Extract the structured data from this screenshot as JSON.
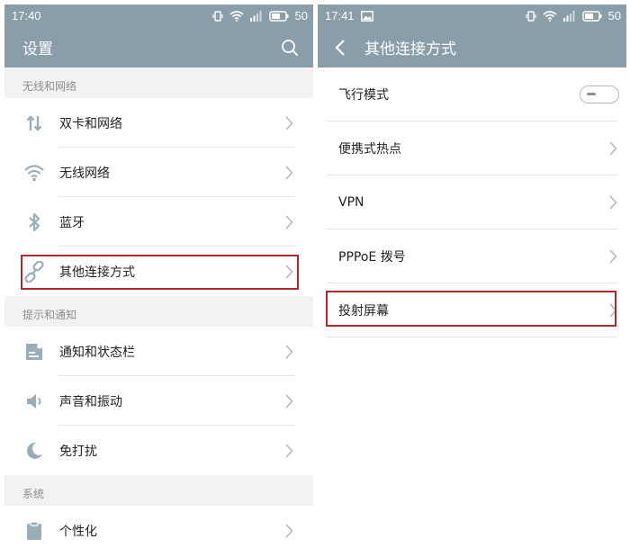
{
  "left": {
    "status": {
      "time": "17:40",
      "battery": "50"
    },
    "title": "设置",
    "sections": [
      {
        "header": "无线和网络",
        "items": [
          {
            "label": "双卡和网络"
          },
          {
            "label": "无线网络"
          },
          {
            "label": "蓝牙"
          },
          {
            "label": "其他连接方式"
          }
        ]
      },
      {
        "header": "提示和通知",
        "items": [
          {
            "label": "通知和状态栏"
          },
          {
            "label": "声音和振动"
          },
          {
            "label": "免打扰"
          }
        ]
      },
      {
        "header": "系统",
        "items": [
          {
            "label": "个性化"
          }
        ]
      }
    ]
  },
  "right": {
    "status": {
      "time": "17:41",
      "battery": "50"
    },
    "title": "其他连接方式",
    "items": [
      {
        "label": "飞行模式"
      },
      {
        "label": "便携式热点"
      },
      {
        "label": "VPN"
      },
      {
        "label": "PPPoE 拨号"
      },
      {
        "label": "投射屏幕"
      }
    ],
    "airplane_mode": "off"
  },
  "colors": {
    "header_bg": "#8a9ea9",
    "icon": "#9aaeb9",
    "highlight": "#b3282d",
    "section_bg": "#f2f2f2"
  },
  "icons": [
    "data-arrows-icon",
    "wifi-icon",
    "bluetooth-icon",
    "link-icon",
    "notification-icon",
    "speaker-icon",
    "moon-icon",
    "clipboard-icon",
    "search-icon",
    "back-arrow-icon",
    "chevron-right-icon",
    "vibrate-icon",
    "wifi-status-icon",
    "signal-icon",
    "battery-icon",
    "image-icon"
  ]
}
